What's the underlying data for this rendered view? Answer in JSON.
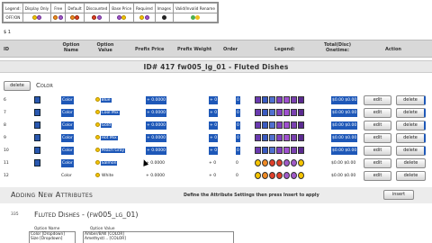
{
  "legend": {
    "headers": [
      "Legend:",
      "Display Only",
      "Free",
      "Default",
      "Discounted",
      "Base Price",
      "Required",
      "Images",
      "Valid/Invalid Rename"
    ],
    "off_on": "OFF/ON"
  },
  "misc": {
    "dollar": "$ 1"
  },
  "columns": {
    "id": "ID",
    "option_name": "Option Name",
    "option_value": "Option Value",
    "prefix_price": "Prefix Price",
    "prefix_weight": "Prefix Weight",
    "order": "Order",
    "legend": "Legend:",
    "total": "Total(Disc) Onetime:",
    "action": "Action"
  },
  "product_header": "ID# 417 fw005_lg_01 - Fluted Dishes",
  "option_group": {
    "delete_label": "delete",
    "name": "Color"
  },
  "rows": [
    {
      "id": "6",
      "name": "Color",
      "value": "Blue",
      "price": "+ 0.0000",
      "weight": "+ 0",
      "order": "0",
      "total": "$0.00 $0.00",
      "highlight": true
    },
    {
      "id": "7",
      "name": "Color",
      "value": "Cool Mix",
      "price": "+ 0.0000",
      "weight": "+ 0",
      "order": "0",
      "total": "$0.00 $0.00",
      "highlight": true
    },
    {
      "id": "8",
      "name": "Color",
      "value": "Gold",
      "price": "+ 0.0000",
      "weight": "+ 0",
      "order": "0",
      "total": "$0.00 $0.00",
      "highlight": true
    },
    {
      "id": "9",
      "name": "Color",
      "value": "Hot Mix",
      "price": "+ 0.0000",
      "weight": "+ 0",
      "order": "0",
      "total": "$0.00 $0.00",
      "highlight": true
    },
    {
      "id": "10",
      "name": "Color",
      "value": "Peach Gray",
      "price": "+ 0.0000",
      "weight": "+ 0",
      "order": "0",
      "total": "$0.00 $0.00",
      "highlight": true
    },
    {
      "id": "11",
      "name": "Color",
      "value": "Salmon",
      "price": "+ 0.0000",
      "weight": "+ 0",
      "order": "0",
      "total": "$0.00 $0.00",
      "highlight": true
    },
    {
      "id": "12",
      "name": "Color",
      "value": "White",
      "price": "+ 0.0000",
      "weight": "+ 0",
      "order": "0",
      "total": "$0.00 $0.00",
      "highlight": false
    }
  ],
  "row_buttons": {
    "edit": "edit",
    "delete": "delete"
  },
  "add_section": {
    "title": "Adding New Attributes",
    "note": "Define the Attribute Settings then press Insert to apply",
    "insert_label": "insert",
    "product_id": "335",
    "product_line": "Fluted Dishes - (fw005_lg_01)",
    "option_name_label": "Option Name",
    "option_value_label": "Option Value",
    "option_name_items": [
      "Color [Dropdown]",
      "Size [Dropdown]"
    ],
    "option_value_items": [
      "Amber/B/W [COLOR]",
      "Amethyst/... [COLOR]"
    ]
  }
}
